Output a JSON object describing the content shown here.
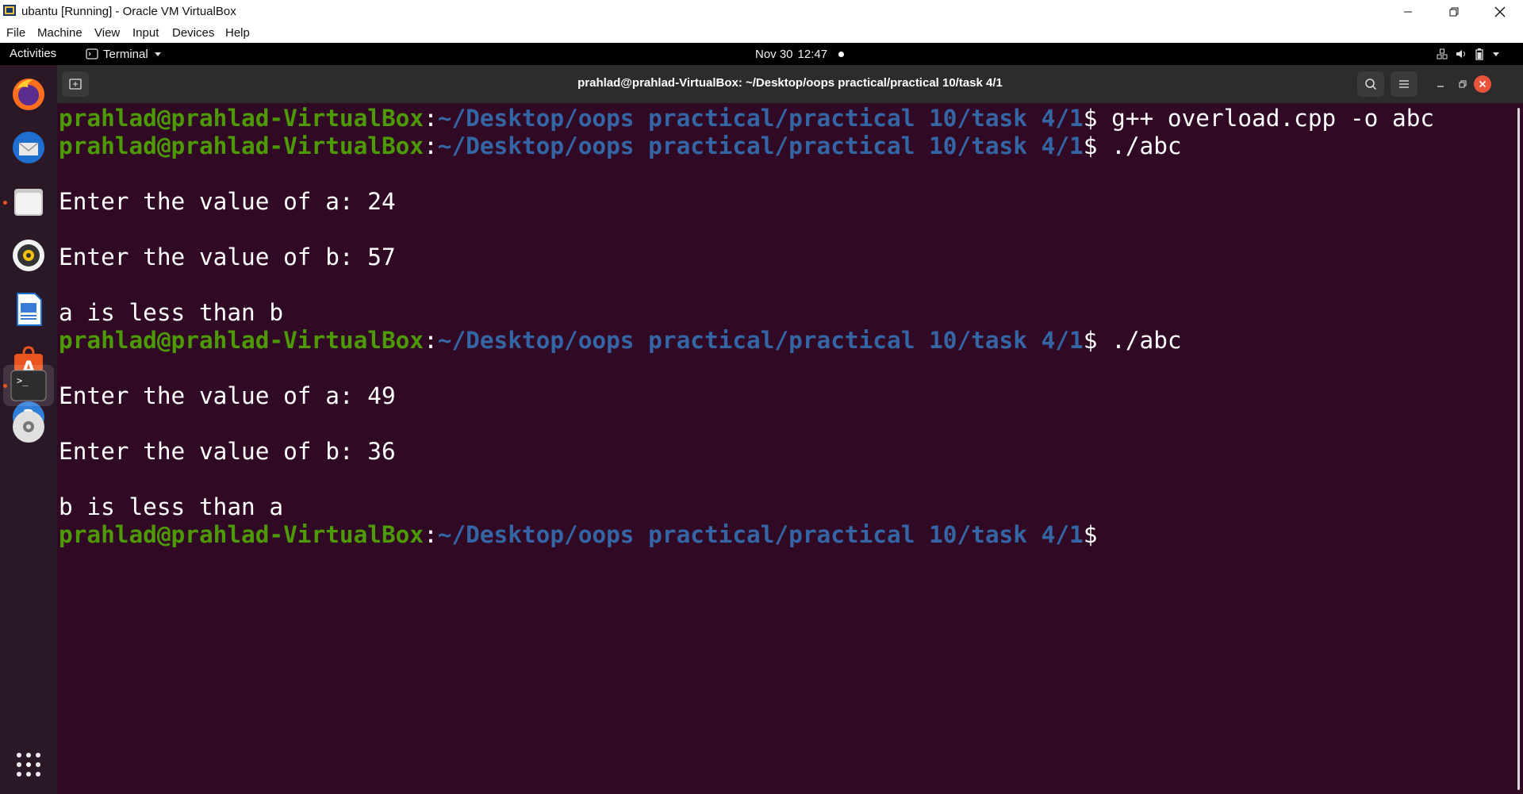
{
  "window": {
    "title": "ubantu [Running] - Oracle VM VirtualBox",
    "menu": [
      "File",
      "Machine",
      "View",
      "Input",
      "Devices",
      "Help"
    ]
  },
  "topbar": {
    "activities": "Activities",
    "app_menu": "Terminal",
    "date": "Nov 30",
    "time": "12:47"
  },
  "dock": {
    "items": [
      "firefox-icon",
      "thunderbird-icon",
      "files-icon",
      "rhythmbox-icon",
      "libreoffice-writer-icon",
      "ubuntu-software-icon",
      "help-icon",
      "terminal-icon",
      "dvd-icon"
    ],
    "show_apps": "show-applications-icon"
  },
  "terminal": {
    "title": "prahlad@prahlad-VirtualBox: ~/Desktop/oops practical/practical 10/task 4/1",
    "prompt_user": "prahlad@prahlad-VirtualBox",
    "prompt_path": "~/Desktop/oops practical/practical 10/task 4/1",
    "lines": [
      {
        "kind": "prompt",
        "cmd": " g++ overload.cpp -o abc"
      },
      {
        "kind": "prompt",
        "cmd": " ./abc"
      },
      {
        "kind": "out",
        "text": ""
      },
      {
        "kind": "out",
        "text": "Enter the value of a: 24"
      },
      {
        "kind": "out",
        "text": ""
      },
      {
        "kind": "out",
        "text": "Enter the value of b: 57"
      },
      {
        "kind": "out",
        "text": ""
      },
      {
        "kind": "out",
        "text": "a is less than b"
      },
      {
        "kind": "prompt",
        "cmd": " ./abc"
      },
      {
        "kind": "out",
        "text": ""
      },
      {
        "kind": "out",
        "text": "Enter the value of a: 49"
      },
      {
        "kind": "out",
        "text": ""
      },
      {
        "kind": "out",
        "text": "Enter the value of b: 36"
      },
      {
        "kind": "out",
        "text": ""
      },
      {
        "kind": "out",
        "text": "b is less than a"
      },
      {
        "kind": "prompt",
        "cmd": ""
      }
    ]
  },
  "colors": {
    "terminal_bg": "#300a24",
    "prompt_user": "#4e9a06",
    "prompt_path": "#3465a4",
    "dock_bg": "#2b1827",
    "header_bg": "#2c2c2c",
    "close_red": "#e9533a"
  }
}
